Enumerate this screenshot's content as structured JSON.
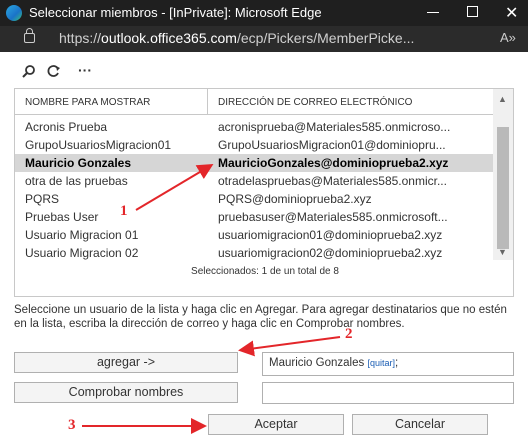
{
  "window": {
    "title": "Seleccionar miembros - [InPrivate]: Microsoft Edge",
    "url_prefix": "https://",
    "url_host": "outlook.office365.com",
    "url_path": "/ecp/Pickers/MemberPicke...",
    "reader_icon": "A»"
  },
  "toolbar": {
    "icons": [
      "search-icon",
      "refresh-icon",
      "more-icon"
    ],
    "more": "···",
    "search": "⚲",
    "refresh": "⟳"
  },
  "table": {
    "columns": [
      "NOMBRE PARA MOSTRAR",
      "DIRECCIÓN DE CORREO ELECTRÓNICO"
    ],
    "rows": [
      {
        "name": "Acronis Prueba",
        "email": "acronisprueba@Materiales585.onmicroso..."
      },
      {
        "name": "GrupoUsuariosMigracion01",
        "email": "GrupoUsuariosMigracion01@dominiopru..."
      },
      {
        "name": "Mauricio Gonzales",
        "email": "MauricioGonzales@dominioprueba2.xyz",
        "selected": true
      },
      {
        "name": "otra de las pruebas",
        "email": "otradelaspruebas@Materiales585.onmicr..."
      },
      {
        "name": "PQRS",
        "email": "PQRS@dominioprueba2.xyz"
      },
      {
        "name": "Pruebas User",
        "email": "pruebasuser@Materiales585.onmicrosoft..."
      },
      {
        "name": "Usuario Migracion 01",
        "email": "usuariomigracion01@dominioprueba2.xyz"
      },
      {
        "name": "Usuario Migracion 02",
        "email": "usuariomigracion02@dominioprueba2.xyz"
      }
    ],
    "count_text": "Seleccionados: 1 de un total de 8"
  },
  "instructions": "Seleccione un usuario de la lista y haga clic en Agregar. Para agregar destinatarios que no estén en la lista, escriba la dirección de correo y haga clic en Comprobar nombres.",
  "add_button": "agregar ->",
  "selected_field": {
    "name": "Mauricio Gonzales",
    "remove_link": "[quitar]",
    "suffix": ";"
  },
  "check_names_button": "Comprobar nombres",
  "accept_button": "Aceptar",
  "cancel_button": "Cancelar",
  "annotations": {
    "one": "1",
    "two": "2",
    "three": "3",
    "color": "#e3262a"
  },
  "colors": {
    "titlebar": "#1f1f1f",
    "selected_row": "#d6d6d6",
    "link": "#1a5db4"
  }
}
